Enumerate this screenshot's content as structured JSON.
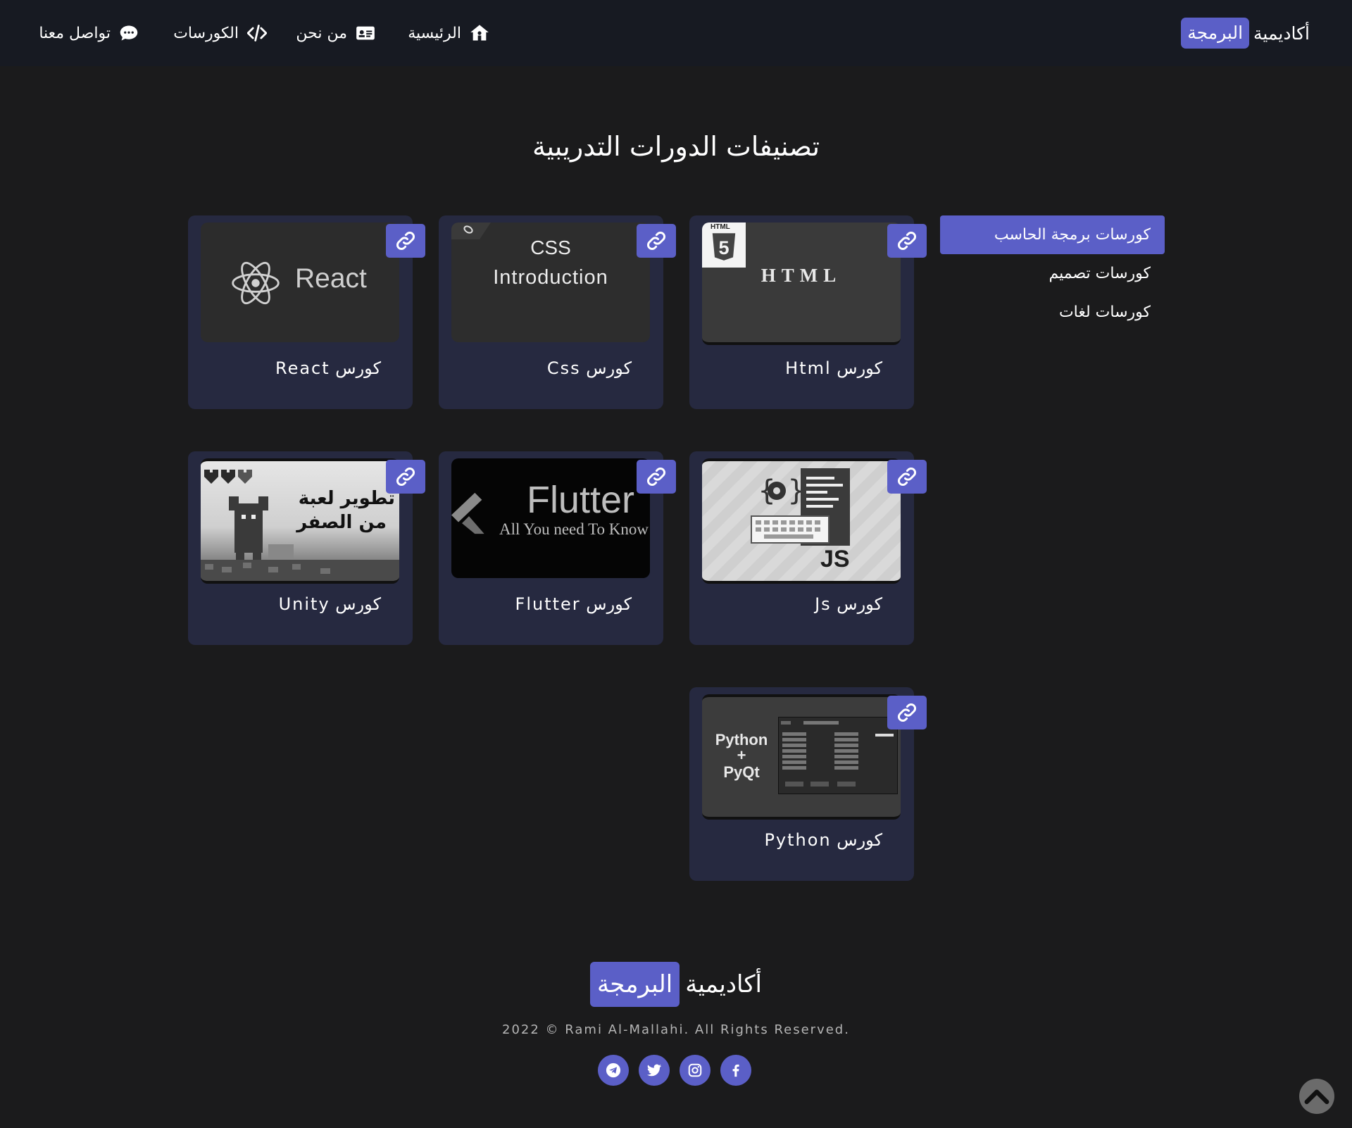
{
  "navbar": {
    "brand_main": "أكاديمية",
    "brand_highlight": "البرمجة",
    "items": [
      {
        "label": "الرئيسية",
        "icon": "home-icon"
      },
      {
        "label": "من نحن",
        "icon": "id-card-icon"
      },
      {
        "label": "الكورسات",
        "icon": "code-icon"
      },
      {
        "label": "تواصل معنا",
        "icon": "chat-icon"
      }
    ]
  },
  "main": {
    "heading": "تصنيفات الدورات التدريبية"
  },
  "sidebar": {
    "items": [
      {
        "label": "كورسات برمجة الحاسب",
        "active": true
      },
      {
        "label": "كورسات تصميم",
        "active": false
      },
      {
        "label": "كورسات لغات",
        "active": false
      }
    ]
  },
  "courses": [
    {
      "title": "كورس Html",
      "thumb_text": "HTML",
      "thumb_badge": "HTML"
    },
    {
      "title": "كورس Css",
      "thumb_text_1": "CSS",
      "thumb_text_2": "Introduction"
    },
    {
      "title": "كورس React",
      "thumb_text": "React"
    },
    {
      "title": "كورس Js",
      "thumb_text": "JS"
    },
    {
      "title": "كورس Flutter",
      "thumb_text_1": "Flutter",
      "thumb_text_2": "All You need To Know"
    },
    {
      "title": "كورس Unity",
      "thumb_text_1": "تطوير لعبة",
      "thumb_text_2": "من الصفر"
    },
    {
      "title": "كورس Python",
      "thumb_text_1": "Python",
      "thumb_text_2": "+",
      "thumb_text_3": "PyQt"
    }
  ],
  "footer": {
    "brand_main": "أكاديمية",
    "brand_highlight": "البرمجة",
    "copyright": "2022 © Rami Al-Mallahi. All Rights Reserved.",
    "socials": [
      "telegram-icon",
      "twitter-icon",
      "instagram-icon",
      "facebook-icon"
    ]
  },
  "colors": {
    "accent": "#5b5fc7",
    "background": "#1b1b1c",
    "navbar": "#171a22",
    "card": "#262940"
  }
}
